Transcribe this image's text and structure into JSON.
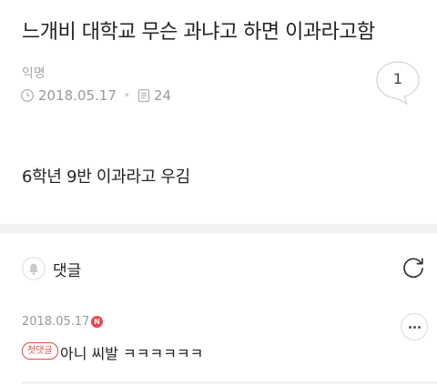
{
  "post": {
    "title": "느개비 대학교 무슨 과냐고 하면 이과라고함",
    "author": "익명",
    "date": "2018.05.17",
    "views": "24",
    "comment_count": "1",
    "body": "6학년 9반 이과라고 우김"
  },
  "comments_section": {
    "label": "댓글"
  },
  "comments": [
    {
      "date": "2018.05.17",
      "new_badge": "N",
      "first_badge": "첫댓글",
      "text": "아니 씨발 ㅋㅋㅋㅋㅋㅋ"
    }
  ],
  "icons": {
    "clock": "clock-icon",
    "views": "document-icon",
    "comment": "speech-bubble-icon",
    "bell": "bell-icon",
    "refresh": "refresh-icon",
    "more": "more-icon"
  },
  "colors": {
    "badge_red": "#e8474b",
    "meta_gray": "#9a9a9a",
    "divider": "#f1f1f3"
  }
}
